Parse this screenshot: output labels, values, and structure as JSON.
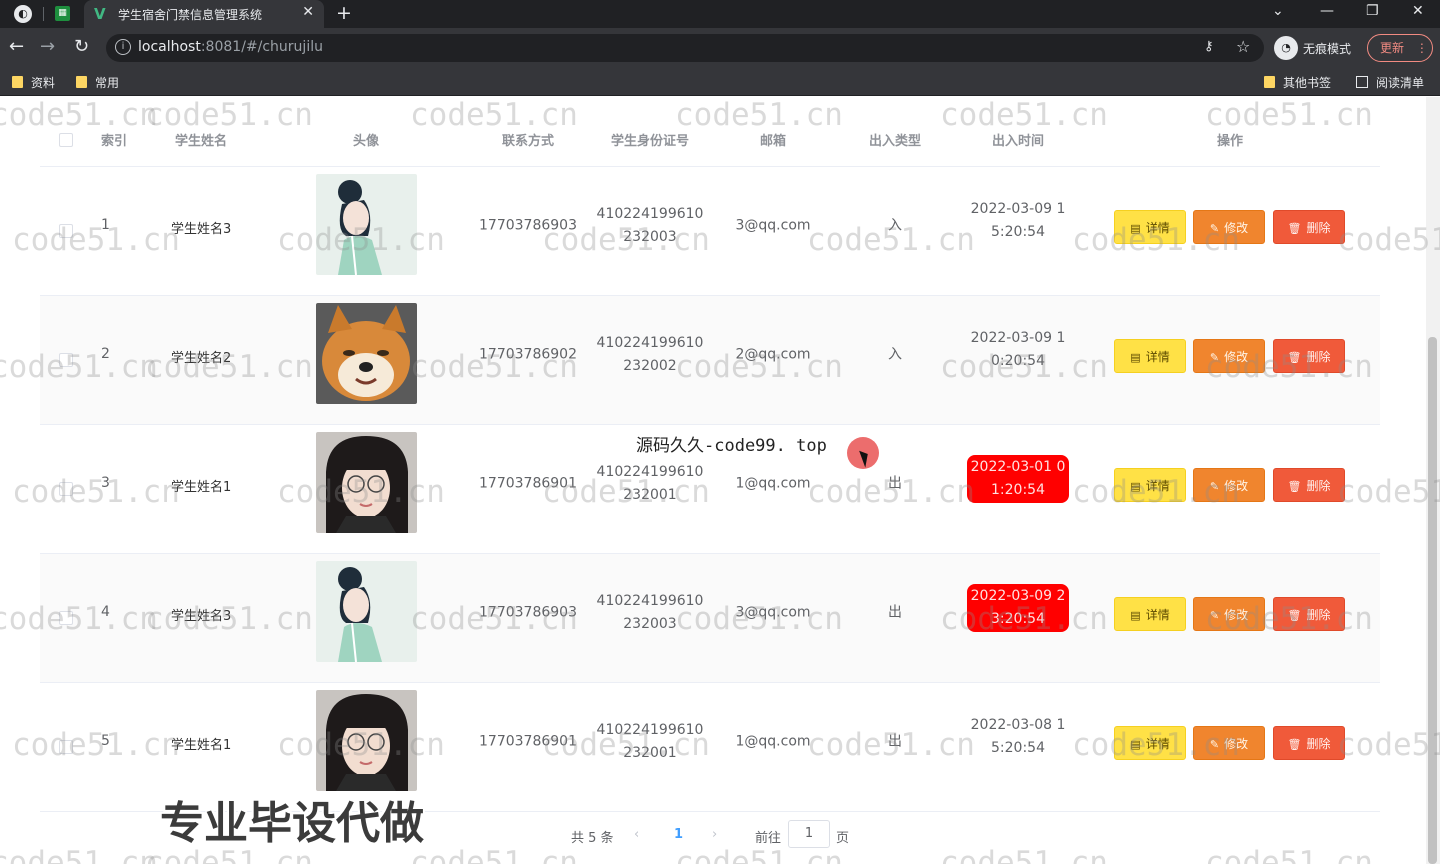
{
  "browser": {
    "tab_title": "学生宿舍门禁信息管理系统",
    "url_host": "localhost",
    "url_rest": ":8081/#/churujilu",
    "incognito_label": "无痕模式",
    "update_label": "更新",
    "bookmarks": [
      "资料",
      "常用"
    ],
    "other_bookmarks": "其他书签",
    "reading_list": "阅读清单"
  },
  "table": {
    "headers": {
      "index": "索引",
      "name": "学生姓名",
      "avatar": "头像",
      "phone": "联系方式",
      "id_card": "学生身份证号",
      "email": "邮箱",
      "type": "出入类型",
      "time": "出入时间",
      "actions": "操作"
    },
    "action_labels": {
      "detail": "详情",
      "edit": "修改",
      "delete": "删除"
    },
    "rows": [
      {
        "index": "1",
        "name": "学生姓名3",
        "avatar": "portrait-green-dress",
        "phone": "17703786903",
        "id_line1": "410224199610",
        "id_line2": "232003",
        "email": "3@qq.com",
        "type": "入",
        "time_line1": "2022-03-09 1",
        "time_line2": "5:20:54",
        "highlight": false
      },
      {
        "index": "2",
        "name": "学生姓名2",
        "avatar": "shiba-dog",
        "phone": "17703786902",
        "id_line1": "410224199610",
        "id_line2": "232002",
        "email": "2@qq.com",
        "type": "入",
        "time_line1": "2022-03-09 1",
        "time_line2": "0:20:54",
        "highlight": false
      },
      {
        "index": "3",
        "name": "学生姓名1",
        "avatar": "portrait-glasses",
        "phone": "17703786901",
        "id_line1": "410224199610",
        "id_line2": "232001",
        "email": "1@qq.com",
        "type": "出",
        "time_line1": "2022-03-01 0",
        "time_line2": "1:20:54",
        "highlight": true
      },
      {
        "index": "4",
        "name": "学生姓名3",
        "avatar": "portrait-green-dress",
        "phone": "17703786903",
        "id_line1": "410224199610",
        "id_line2": "232003",
        "email": "3@qq.com",
        "type": "出",
        "time_line1": "2022-03-09 2",
        "time_line2": "3:20:54",
        "highlight": true
      },
      {
        "index": "5",
        "name": "学生姓名1",
        "avatar": "portrait-glasses",
        "phone": "17703786901",
        "id_line1": "410224199610",
        "id_line2": "232001",
        "email": "1@qq.com",
        "type": "出",
        "time_line1": "2022-03-08 1",
        "time_line2": "5:20:54",
        "highlight": false
      }
    ]
  },
  "pagination": {
    "total": "共 5 条",
    "prev_icon": "‹",
    "current": "1",
    "next_icon": "›",
    "goto": "前往",
    "goto_value": "1",
    "page_suffix": "页"
  },
  "overlay": {
    "caption": "源码久久-code99. top",
    "promo": "专业毕设代做",
    "watermark": "code51.cn"
  },
  "colors": {
    "highlight_time": "#ff0000",
    "btn_detail": "#ffe146",
    "btn_edit": "#f0852e",
    "btn_delete": "#f05a3a",
    "pager_current": "#409eff"
  }
}
